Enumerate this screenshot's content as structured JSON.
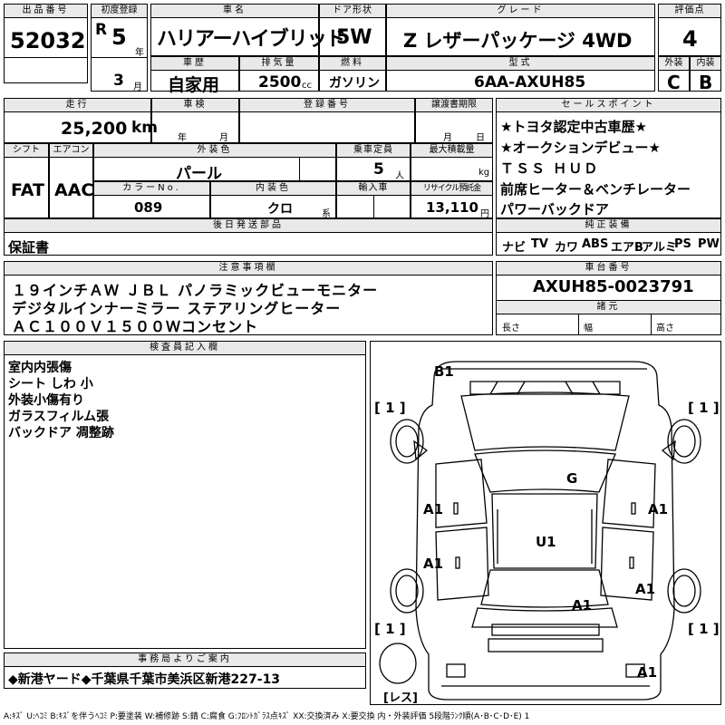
{
  "headers": {
    "lot_no": "出品番号",
    "first_reg": "初度登録",
    "car_name": "車名",
    "door": "ドア形状",
    "grade": "グレード",
    "score": "評価点",
    "history": "車歴",
    "displacement": "排気量",
    "fuel": "燃料",
    "model_code": "型式",
    "exterior": "外装",
    "interior": "内装",
    "mileage": "走行",
    "inspection": "車検",
    "reg_no": "登録番号",
    "transfer_doc": "譲渡書期限",
    "sales_point": "セールスポイント",
    "shift": "シフト",
    "aircon": "エアコン",
    "ext_color": "外装色",
    "capacity": "乗車定員",
    "max_load": "最大積載量",
    "color_no": "カラーNo.",
    "int_color": "内装色",
    "import": "輸入車",
    "recycle": "リサイクル預託金",
    "later_parts": "後日発送部品",
    "genuine": "純正装備",
    "notes": "注意事項欄",
    "chassis": "車台番号",
    "dims": "諸元",
    "inspector": "検査員記入欄",
    "office": "事務局よりご案内"
  },
  "vehicle": {
    "lot_number": "52032",
    "era": "R",
    "year": "5",
    "year_unit": "年",
    "month": "3",
    "month_unit": "月",
    "name": "ハリアーハイブリッド",
    "door": "5W",
    "grade": "Z レザーパッケージ 4WD",
    "score": "4",
    "history": "自家用",
    "displacement": "2500",
    "displacement_unit": "cc",
    "fuel": "ガソリン",
    "model_code": "6AA-AXUH85",
    "exterior_grade": "C",
    "interior_grade": "B",
    "mileage": "25,200",
    "mileage_unit": "km",
    "inspection_year_unit": "年",
    "inspection_month_unit": "月",
    "transfer_month_unit": "月",
    "transfer_day_unit": "日",
    "shift": "FAT",
    "aircon": "AAC",
    "ext_color": "パール",
    "capacity": "5",
    "capacity_unit": "人",
    "max_load_unit": "kg",
    "color_no": "089",
    "int_color": "クロ",
    "int_color_suffix": "系",
    "recycle_fee": "13,110",
    "recycle_unit": "円",
    "later_parts": "保証書",
    "chassis_no": "AXUH85-0023791",
    "dim_length": "長さ",
    "dim_width": "幅",
    "dim_height": "高さ"
  },
  "sales_points": [
    "★トヨタ認定中古車歴★",
    "★オークションデビュー★",
    "ＴＳＳ ＨＵＤ",
    "前席ヒーター＆ベンチレーター",
    "パワーバックドア"
  ],
  "genuine_equipment": [
    "ナビ",
    "TV",
    "カワ",
    "ABS",
    "エアB",
    "アルミ",
    "PS",
    "PW"
  ],
  "notes": [
    "１９インチＡＷ ＪＢＬ パノラミックビューモニター",
    "デジタルインナーミラー ステアリングヒーター",
    "ＡＣ１００Ｖ１５００Ｗコンセント"
  ],
  "inspector_notes": [
    "室内内張傷",
    "シート しわ 小",
    "外装小傷有り",
    "ガラスフィルム張",
    "バックドア 凋整跡"
  ],
  "diagram_marks": {
    "b1": "B1",
    "g": "G",
    "u1": "U1",
    "a1_fl": "A1",
    "a1_fr": "A1",
    "a1_rl": "A1",
    "a1_rc": "A1",
    "a1_rr": "A1",
    "a1_bottom": "A1",
    "tire_fl": "[ 1 ]",
    "tire_fr": "[ 1 ]",
    "tire_rl": "[ 1 ]",
    "tire_rr": "[ 1 ]",
    "spare": "[レス]"
  },
  "office_notice": "◆新港ヤード◆千葉県千葉市美浜区新港227-13",
  "legend": "A:ｷｽﾞ U:ﾍｺﾐ B:ｷｽﾞを伴うﾍｺﾐ P:要塗装 W:補修跡 S:錆 C:腐食 G:ﾌﾛﾝﾄｶﾞﾗｽ点ｷｽﾞ XX:交換済み X:要交換 内・外装評価 5段階ﾗﾝｸ順(A･B･C･D･E) 1"
}
